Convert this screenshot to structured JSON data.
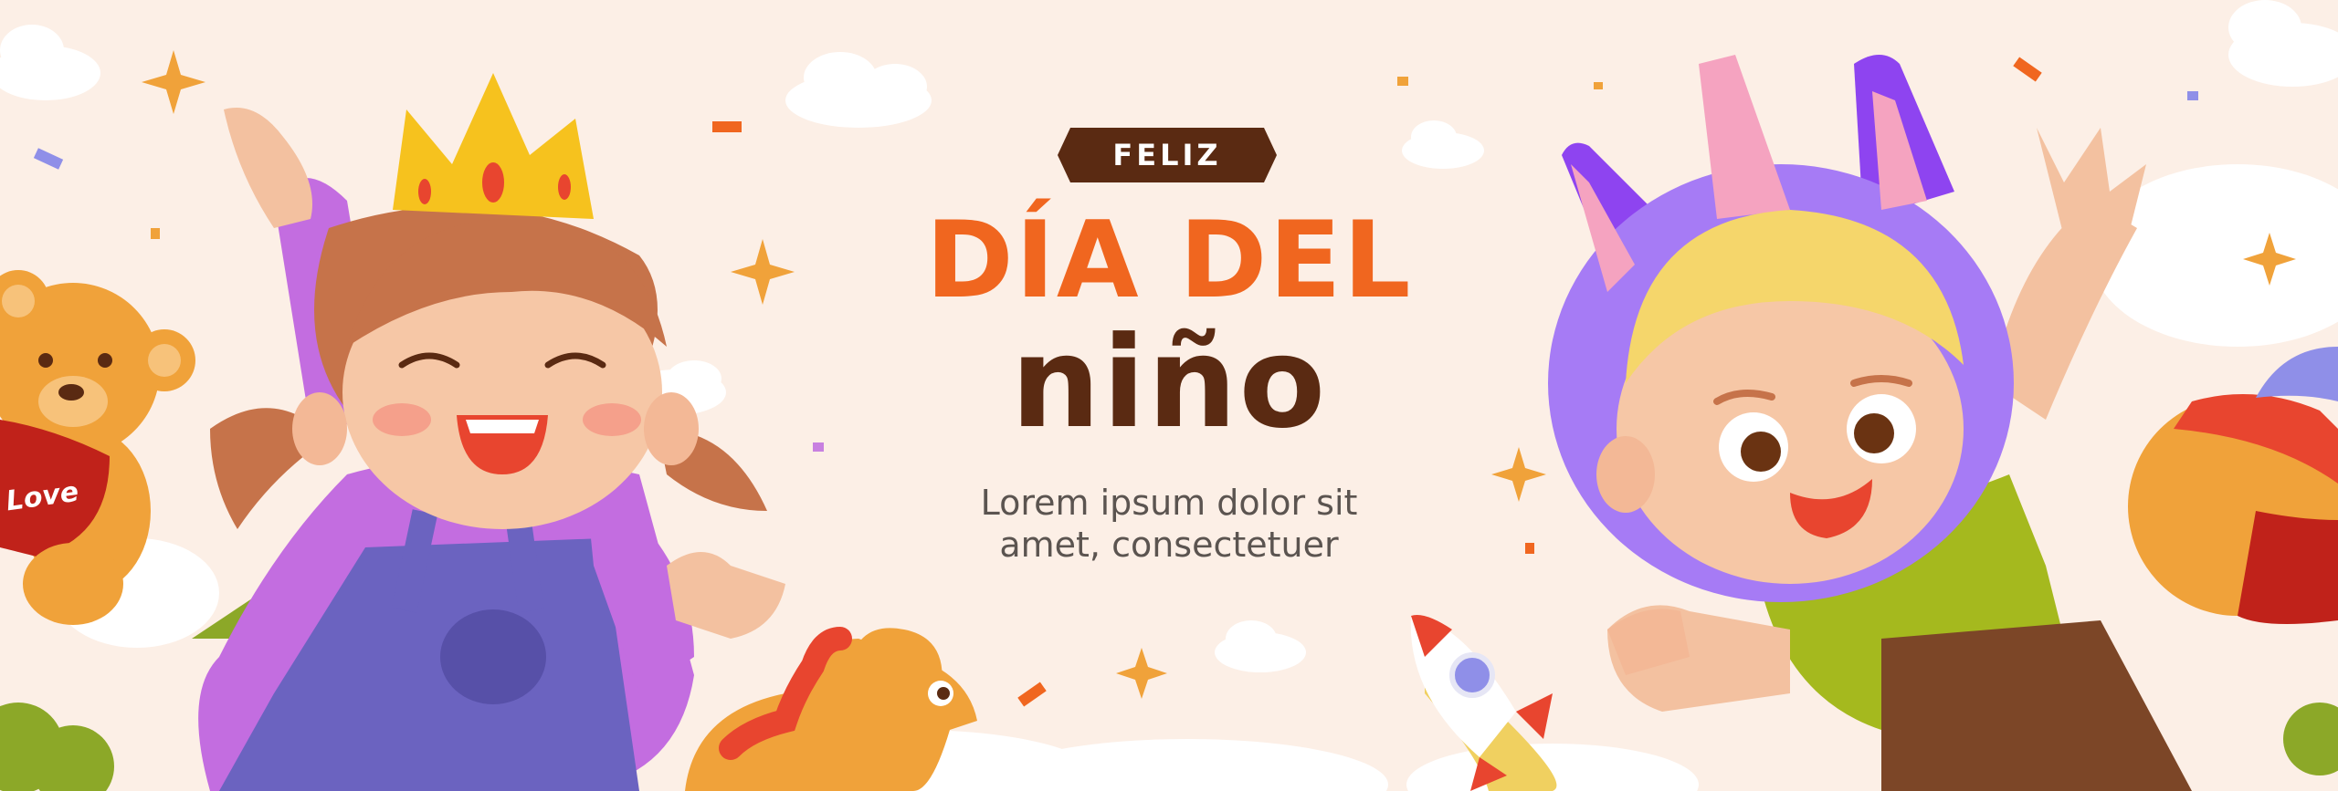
{
  "banner": {
    "badge": "FELIZ",
    "title_line1": "DÍA DEL",
    "title_line2": "niño",
    "subtitle_line1": "Lorem ipsum dolor sit",
    "subtitle_line2": "amet, consectetuer",
    "teddy_heart_text": "Love"
  },
  "colors": {
    "background": "#fcefe6",
    "accent_orange": "#f0661f",
    "brown": "#5a2a12",
    "text_gray": "#5b5450"
  },
  "icons": [
    "teddy-bear-icon",
    "crown-icon",
    "unicorn-hood-icon",
    "ball-icon",
    "rocket-icon",
    "dinosaur-toy-icon",
    "star-icon",
    "cloud-icon",
    "confetti-icon"
  ]
}
